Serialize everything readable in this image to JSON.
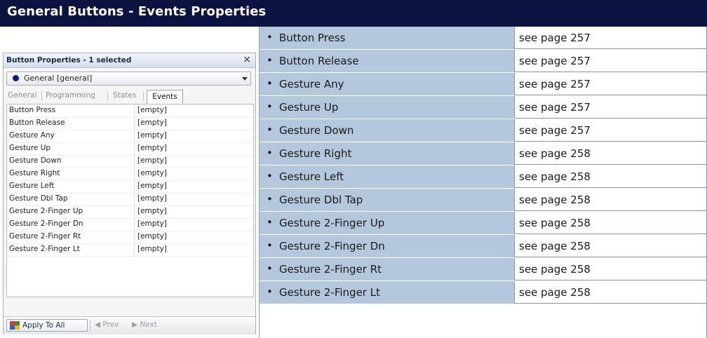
{
  "header": {
    "title": "General Buttons - Events Properties"
  },
  "panel": {
    "title": "Button Properties - 1 selected",
    "close_glyph": "×",
    "dropdown_value": "General  [general]",
    "tabs": [
      {
        "label": "General",
        "active": false
      },
      {
        "label": "Programming",
        "active": false
      },
      {
        "label": "States",
        "active": false
      },
      {
        "label": "Events",
        "active": true
      }
    ],
    "properties": [
      {
        "name": "Button Press",
        "value": "[empty]"
      },
      {
        "name": "Button Release",
        "value": "[empty]"
      },
      {
        "name": "Gesture Any",
        "value": "[empty]"
      },
      {
        "name": "Gesture Up",
        "value": "[empty]"
      },
      {
        "name": "Gesture Down",
        "value": "[empty]"
      },
      {
        "name": "Gesture Right",
        "value": "[empty]"
      },
      {
        "name": "Gesture Left",
        "value": "[empty]"
      },
      {
        "name": "Gesture Dbl Tap",
        "value": "[empty]"
      },
      {
        "name": "Gesture 2-Finger Up",
        "value": "[empty]"
      },
      {
        "name": "Gesture 2-Finger Dn",
        "value": "[empty]"
      },
      {
        "name": "Gesture 2-Finger Rt",
        "value": "[empty]"
      },
      {
        "name": "Gesture 2-Finger Lt",
        "value": "[empty]"
      }
    ],
    "apply_label": "Apply To All",
    "prev_label": "◀  Prev",
    "next_label": "▶  Next"
  },
  "events": [
    {
      "name": "Button Press",
      "page": "see page 257"
    },
    {
      "name": "Button Release",
      "page": "see page 257"
    },
    {
      "name": "Gesture Any",
      "page": "see page 257"
    },
    {
      "name": "Gesture Up",
      "page": "see page 257"
    },
    {
      "name": "Gesture Down",
      "page": "see page 257"
    },
    {
      "name": "Gesture Right",
      "page": "see page 258"
    },
    {
      "name": "Gesture Left",
      "page": "see page 258"
    },
    {
      "name": "Gesture Dbl Tap",
      "page": "see page 258"
    },
    {
      "name": "Gesture 2-Finger Up",
      "page": "see page 258"
    },
    {
      "name": "Gesture 2-Finger Dn",
      "page": "see page 258"
    },
    {
      "name": "Gesture 2-Finger Rt",
      "page": "see page 258"
    },
    {
      "name": "Gesture 2-Finger Lt",
      "page": "see page 258"
    }
  ],
  "bullet": "•",
  "colors": {
    "header_bg": "#0c1340",
    "event_cell_bg": "#b3c7dd"
  },
  "icons": {
    "dropdown_marker": "circle-bullet-icon",
    "apply": "apply-all-icon"
  }
}
